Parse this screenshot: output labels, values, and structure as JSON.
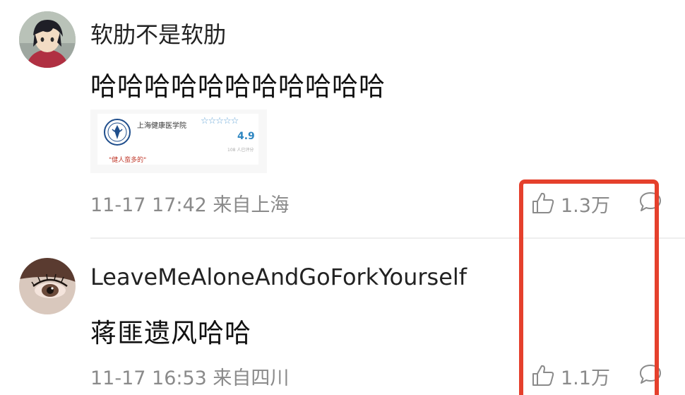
{
  "comments": [
    {
      "username": "软肋不是软肋",
      "text": "哈哈哈哈哈哈哈哈哈哈哈",
      "attachment": {
        "title": "上海健康医学院",
        "stars": "☆☆☆☆☆",
        "score": "4.9",
        "rating_count": "108 人已评分",
        "quote": "\"健人蛮多的\""
      },
      "meta": "11-17 17:42 来自上海",
      "likes": "1.3万",
      "icons": {
        "like": "thumbs-up-icon",
        "comment": "comment-bubble-icon"
      }
    },
    {
      "username": "LeaveMeAloneAndGoForkYourself",
      "text": "蒋匪遗风哈哈",
      "meta": "11-17 16:53 来自四川",
      "likes": "1.1万",
      "icons": {
        "like": "thumbs-up-icon",
        "comment": "comment-bubble-icon"
      }
    }
  ],
  "colors": {
    "highlight": "#e5402c",
    "meta_text": "#8a8a8a",
    "divider": "#eeeeee"
  }
}
